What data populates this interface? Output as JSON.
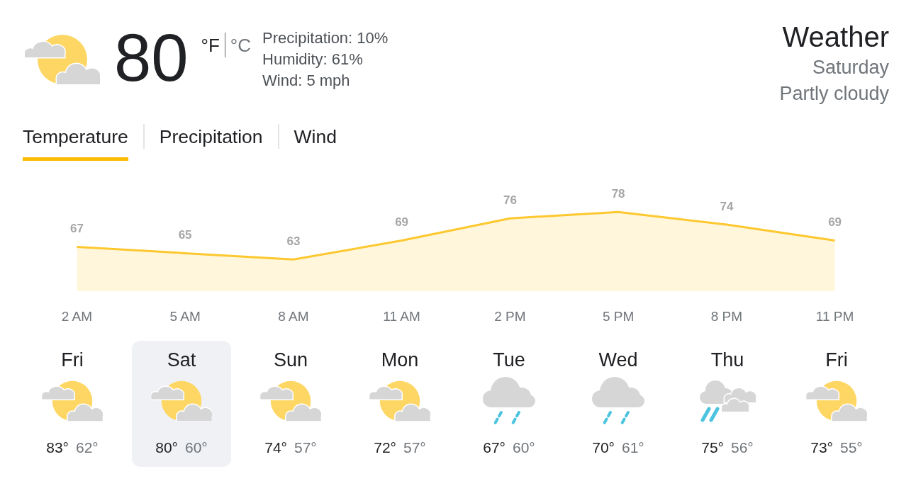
{
  "current": {
    "kind": "partlycloudy",
    "temperature": "80",
    "units": [
      {
        "label": "°F",
        "selected": true
      },
      {
        "label": "°C",
        "selected": false
      }
    ],
    "details": [
      "Precipitation: 10%",
      "Humidity: 61%",
      "Wind: 5 mph"
    ]
  },
  "header": {
    "title": "Weather",
    "day": "Saturday",
    "condition": "Partly cloudy"
  },
  "tabs": [
    {
      "label": "Temperature",
      "selected": true
    },
    {
      "label": "Precipitation",
      "selected": false
    },
    {
      "label": "Wind",
      "selected": false
    }
  ],
  "hourly": {
    "chart_data": {
      "type": "area",
      "categories": [
        "2 AM",
        "5 AM",
        "8 AM",
        "11 AM",
        "2 PM",
        "5 PM",
        "8 PM",
        "11 PM"
      ],
      "series": [
        {
          "color": "#fdc82f",
          "values": [
            67,
            65,
            63,
            69,
            76,
            78,
            74,
            69
          ]
        }
      ],
      "data_labels": true
    }
  },
  "days": [
    {
      "name": "Fri",
      "kind": "partlycloudy",
      "high": "83°",
      "low": "62°",
      "selected": false
    },
    {
      "name": "Sat",
      "kind": "partlycloudy",
      "high": "80°",
      "low": "60°",
      "selected": true
    },
    {
      "name": "Sun",
      "kind": "partlycloudy",
      "high": "74°",
      "low": "57°",
      "selected": false
    },
    {
      "name": "Mon",
      "kind": "partlycloudy",
      "high": "72°",
      "low": "57°",
      "selected": false
    },
    {
      "name": "Tue",
      "kind": "rain",
      "high": "67°",
      "low": "60°",
      "selected": false
    },
    {
      "name": "Wed",
      "kind": "rain",
      "high": "70°",
      "low": "61°",
      "selected": false
    },
    {
      "name": "Thu",
      "kind": "showers",
      "high": "75°",
      "low": "56°",
      "selected": false
    },
    {
      "name": "Fri",
      "kind": "partlycloudy",
      "high": "73°",
      "low": "55°",
      "selected": false
    }
  ]
}
